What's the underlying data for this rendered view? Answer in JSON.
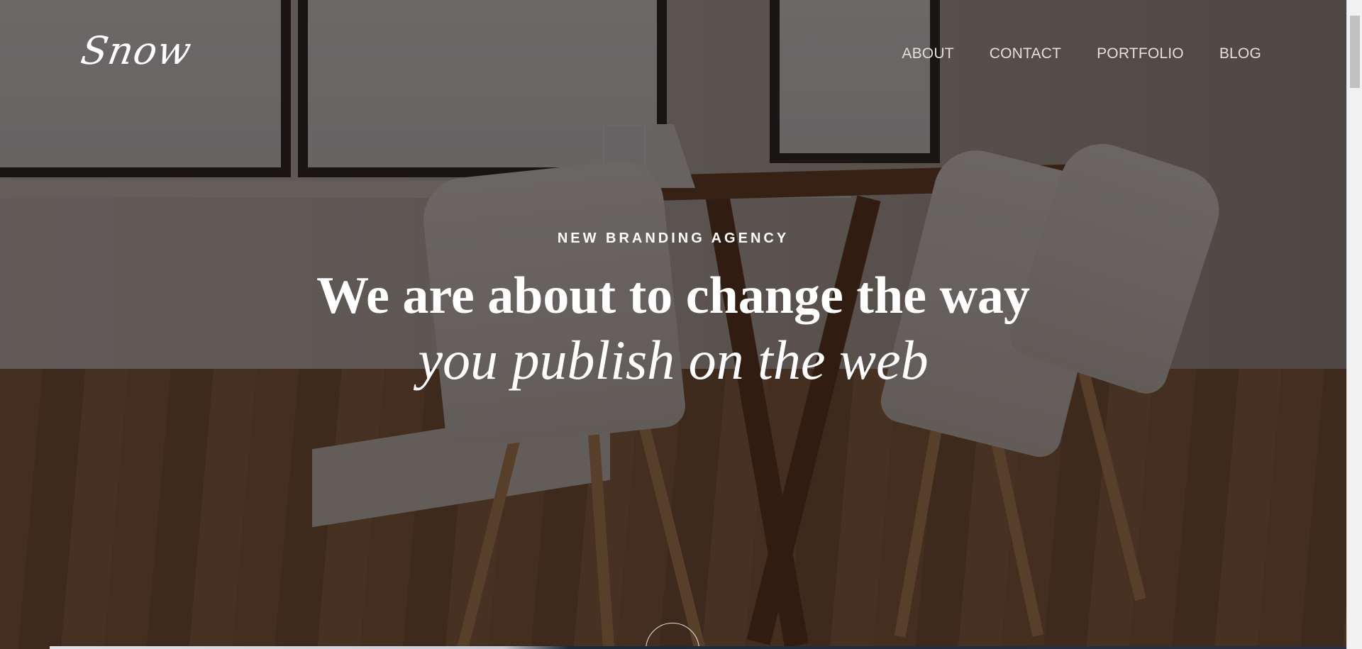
{
  "brand": {
    "logo_text": "Snow"
  },
  "nav": {
    "items": [
      {
        "label": "ABOUT"
      },
      {
        "label": "CONTACT"
      },
      {
        "label": "PORTFOLIO"
      },
      {
        "label": "BLOG"
      }
    ]
  },
  "hero": {
    "eyebrow": "NEW BRANDING AGENCY",
    "headline_line1": "We are about to change the way",
    "headline_line2": "you publish on the web",
    "scroll_icon": "chevron-down-icon"
  },
  "colors": {
    "text": "#ffffff",
    "nav_text": "#e3dfdc",
    "overlay": "#181210"
  }
}
